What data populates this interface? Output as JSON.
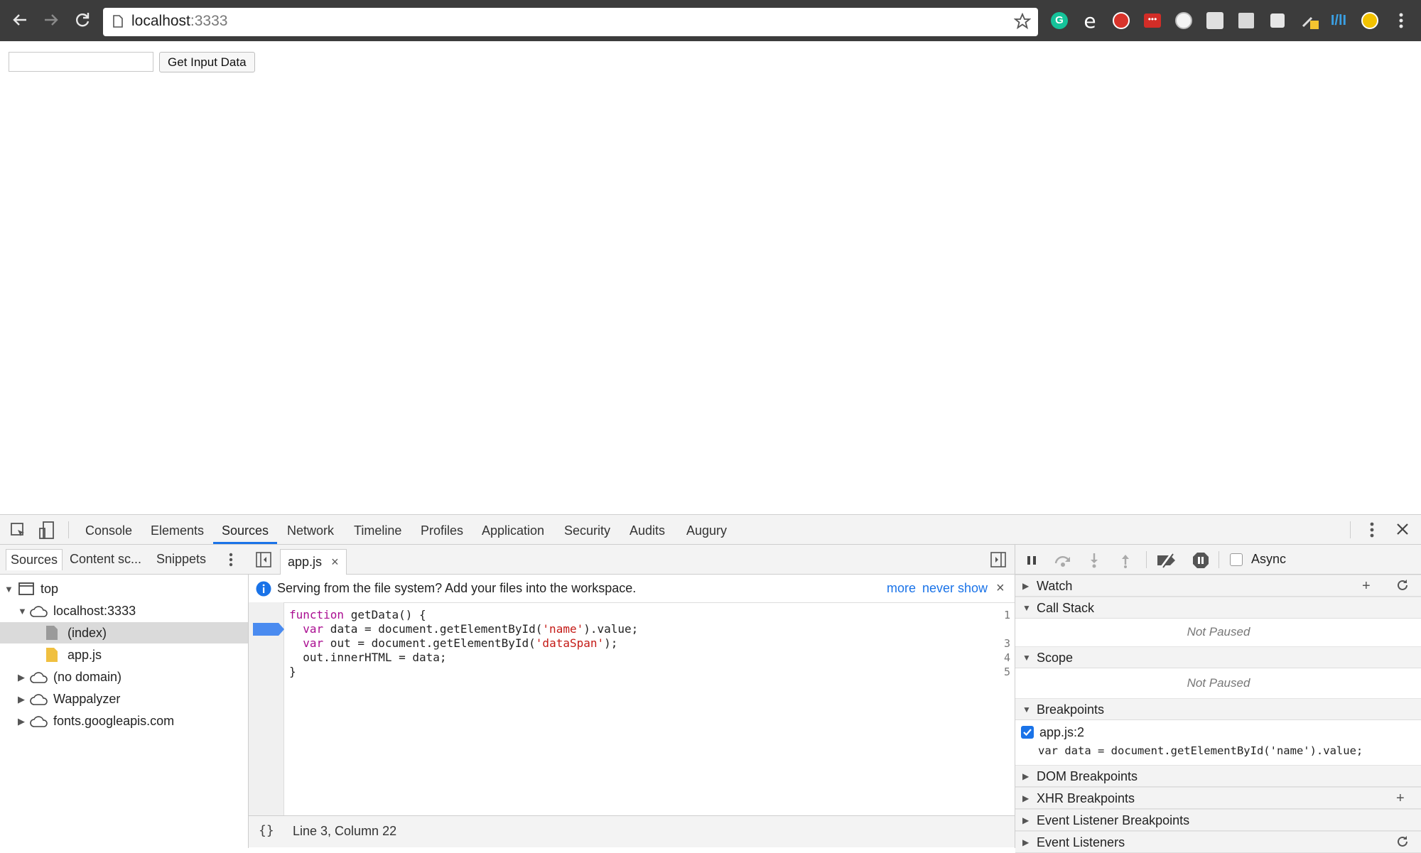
{
  "browser": {
    "url_host": "localhost",
    "url_port": ":3333",
    "icons": [
      "back-arrow-icon",
      "forward-arrow-icon",
      "reload-icon",
      "page-icon",
      "bookmark-star-icon",
      "grammarly-icon",
      "e-extension-icon",
      "adblock-icon",
      "lastpass-icon",
      "circle-extension-icon",
      "gear-extension-icon",
      "reader-extension-icon",
      "extension-icon",
      "color-picker-icon",
      "wappalyzer-icon",
      "moon-extension-icon",
      "chrome-menu-icon"
    ]
  },
  "page": {
    "input_value": "",
    "button_label": "Get Input Data"
  },
  "devtools": {
    "tabs": [
      "Console",
      "Elements",
      "Sources",
      "Network",
      "Timeline",
      "Profiles",
      "Application",
      "Security",
      "Audits",
      "Augury"
    ],
    "active_tab": "Sources",
    "navigator": {
      "tabs": [
        "Sources",
        "Content sc...",
        "Snippets"
      ],
      "tree": [
        {
          "label": "top"
        },
        {
          "label": "localhost:3333"
        },
        {
          "label": "(index)"
        },
        {
          "label": "app.js"
        },
        {
          "label": "(no domain)"
        },
        {
          "label": "Wappalyzer"
        },
        {
          "label": "fonts.googleapis.com"
        }
      ]
    },
    "editor": {
      "file_tab": "app.js",
      "infobar_message": "Serving from the file system? Add your files into the workspace.",
      "infobar_more": "more",
      "infobar_never_show": "never show",
      "line_numbers": [
        "1",
        "2",
        "3",
        "4",
        "5"
      ],
      "breakpoint_line": 2,
      "code": {
        "l1_kw": "function",
        "l1_rest": " getData() {",
        "l2_indent": "  ",
        "l2_kw": "var",
        "l2_mid": " data = document.getElementById(",
        "l2_str": "'name'",
        "l2_end": ").value;",
        "l3_indent": "  ",
        "l3_kw": "var",
        "l3_mid": " out = document.getElementById(",
        "l3_str": "'dataSpan'",
        "l3_end": ");",
        "l4": "  out.innerHTML = data;",
        "l5": "}"
      },
      "status_format_icon": "{}",
      "status_position": "Line 3, Column 22"
    },
    "debugger": {
      "async_label": "Async",
      "watch": "Watch",
      "call_stack": "Call Stack",
      "call_stack_status": "Not Paused",
      "scope": "Scope",
      "scope_status": "Not Paused",
      "breakpoints": "Breakpoints",
      "breakpoint_item": "app.js:2",
      "breakpoint_code": "var data = document.getElementById('name').value;",
      "dom_breakpoints": "DOM Breakpoints",
      "xhr_breakpoints": "XHR Breakpoints",
      "event_listener_breakpoints": "Event Listener Breakpoints",
      "event_listeners": "Event Listeners"
    }
  },
  "colors": {
    "chrome_bg": "#3c3c3c",
    "accent_blue": "#1a73e8",
    "breakpoint_blue": "#4a8bf0",
    "keyword": "#aa0d91",
    "string": "#c41a16"
  }
}
